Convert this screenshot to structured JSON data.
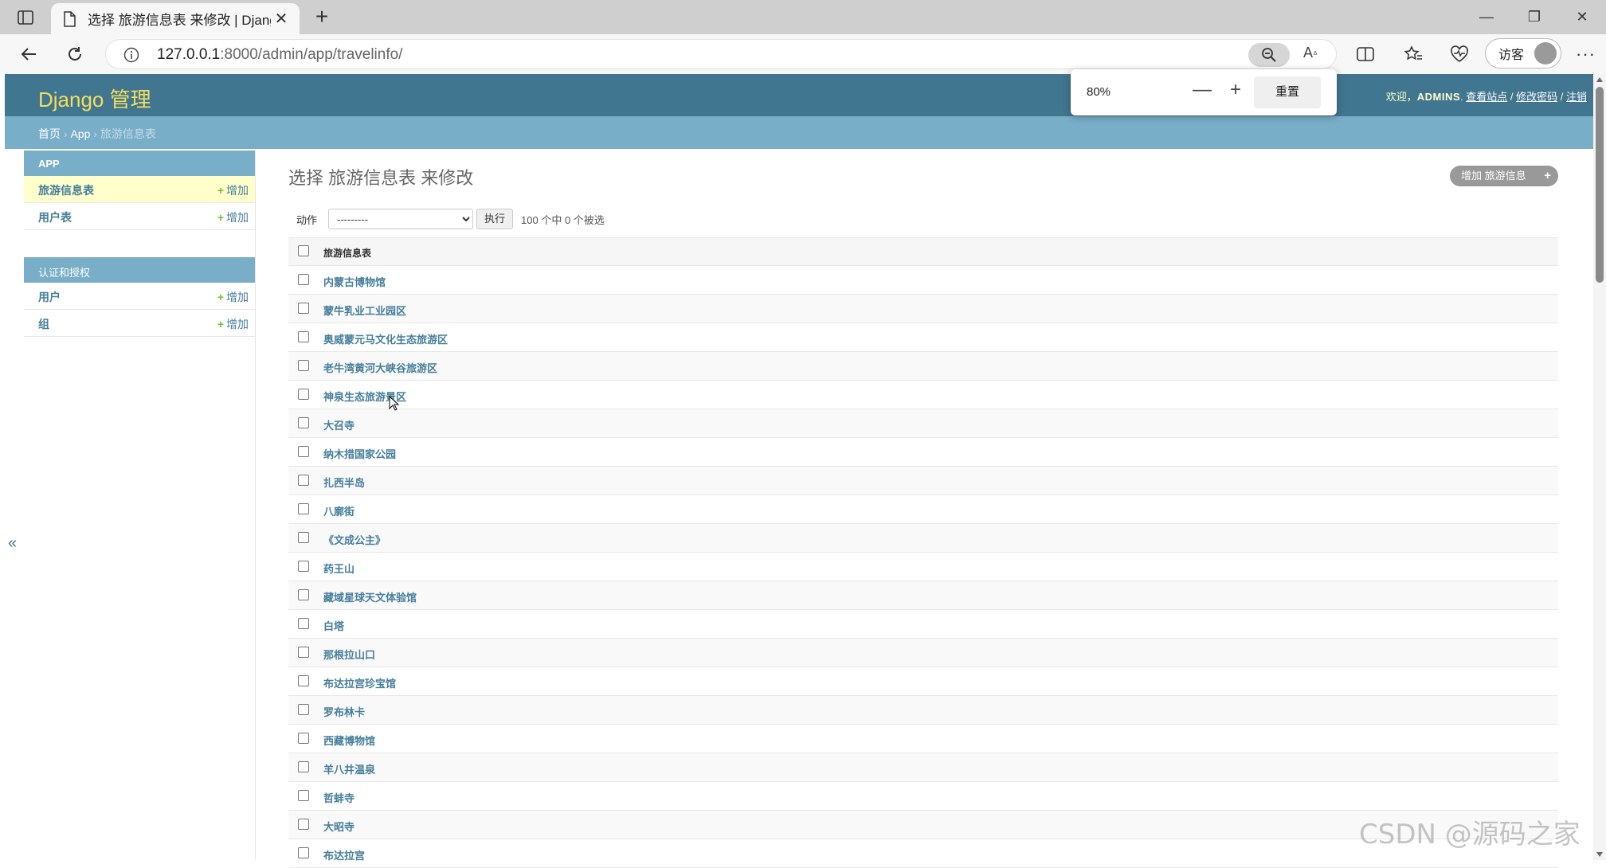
{
  "browser": {
    "tab_title": "选择 旅游信息表 来修改 | Django",
    "url_host": "127.0.0.1",
    "url_rest": ":8000/admin/app/travelinfo/",
    "guest_label": "访客",
    "zoom": {
      "value": "80%",
      "minus": "—",
      "plus": "+",
      "reset": "重置"
    }
  },
  "header": {
    "branding": "Django 管理",
    "welcome": "欢迎，",
    "username": "ADMINS",
    "view_site": "查看站点",
    "change_password": "修改密码",
    "logout": "注销",
    "sep": " / "
  },
  "breadcrumbs": {
    "home": "首页",
    "app": "App",
    "current": "旅游信息表",
    "sep": " › "
  },
  "sidebar": {
    "toggle": "«",
    "add_label": "增加",
    "modules": [
      {
        "caption": "APP",
        "items": [
          "旅游信息表",
          "用户表"
        ]
      },
      {
        "caption": "认证和授权",
        "items": [
          "用户",
          "组"
        ]
      }
    ]
  },
  "content": {
    "title": "选择 旅游信息表 来修改",
    "add_button": "增加 旅游信息表",
    "action_label": "动作",
    "action_select_value": "---------",
    "go_button": "执行",
    "counter": "100 个中 0 个被选",
    "column_header": "旅游信息表",
    "rows": [
      "内蒙古博物馆",
      "蒙牛乳业工业园区",
      "奥威蒙元马文化生态旅游区",
      "老牛湾黄河大峡谷旅游区",
      "神泉生态旅游景区",
      "大召寺",
      "纳木措国家公园",
      "扎西半岛",
      "八廓街",
      "《文成公主》",
      "药王山",
      "藏域星球天文体验馆",
      "白塔",
      "那根拉山口",
      "布达拉宫珍宝馆",
      "罗布林卡",
      "西藏博物馆",
      "羊八井温泉",
      "哲蚌寺",
      "大昭寺",
      "布达拉宫"
    ]
  },
  "watermark": "CSDN @源码之家"
}
